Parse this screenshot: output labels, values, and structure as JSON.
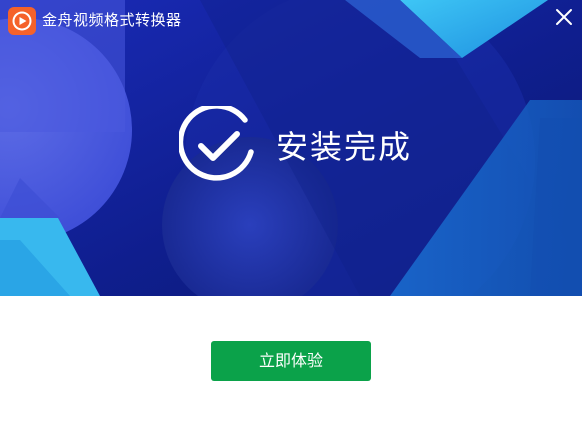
{
  "window": {
    "title": "金舟视频格式转换器",
    "close_icon": "close-icon",
    "logo_icon": "play-logo-icon"
  },
  "status": {
    "message": "安装完成",
    "icon": "check-circle-icon"
  },
  "actions": {
    "primary_label": "立即体验"
  },
  "colors": {
    "banner_bg": "#13209a",
    "accent_cyan": "#36b8f0",
    "button_green": "#0ba24a",
    "logo_orange": "#f5622a",
    "text_white": "#ffffff"
  }
}
